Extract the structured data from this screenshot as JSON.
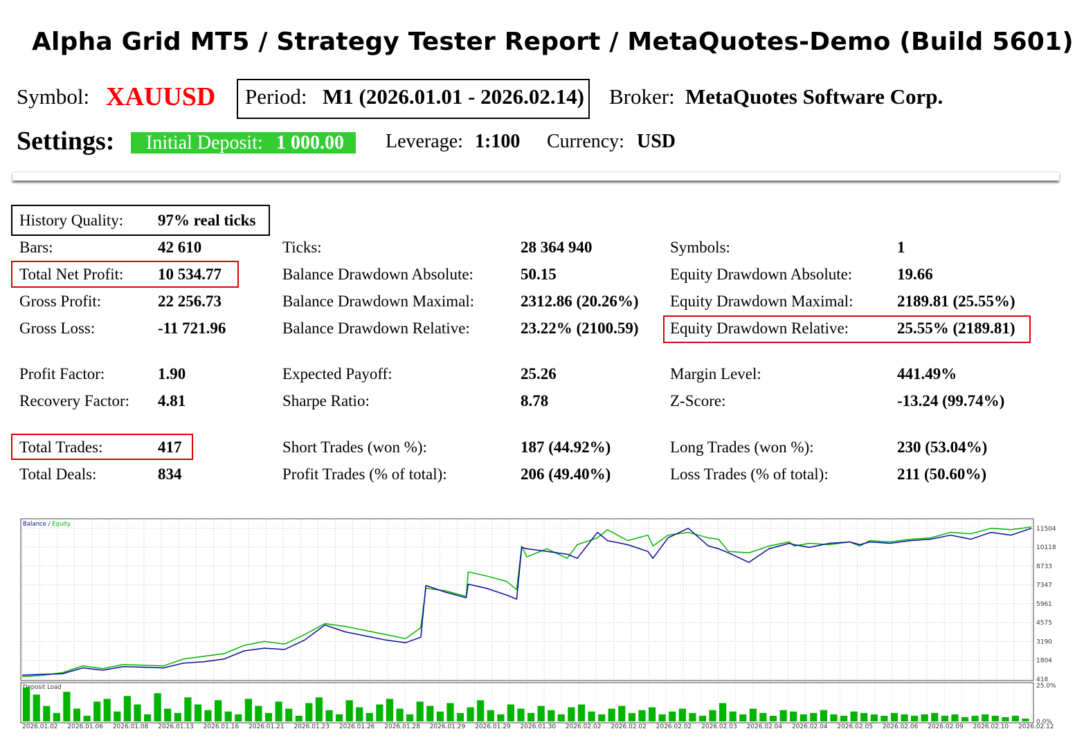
{
  "header": {
    "title": "Alpha Grid MT5  /  Strategy Tester Report  /  MetaQuotes-Demo (Build 5601)",
    "symbol_label": "Symbol:",
    "symbol_value": "XAUUSD",
    "period_label": "Period:",
    "period_value": "M1 (2026.01.01 - 2026.02.14)",
    "broker_label": "Broker:",
    "broker_value": "MetaQuotes Software Corp.",
    "settings_label": "Settings:",
    "deposit_label": "Initial Deposit:",
    "deposit_value": "1 000.00",
    "leverage_label": "Leverage:",
    "leverage_value": "1:100",
    "currency_label": "Currency:",
    "currency_value": "USD"
  },
  "stats": {
    "history_quality": {
      "label": "History Quality:",
      "value": "97% real ticks"
    },
    "bars": {
      "label": "Bars:",
      "value": "42 610"
    },
    "total_net_profit": {
      "label": "Total Net Profit:",
      "value": "10 534.77"
    },
    "gross_profit": {
      "label": "Gross Profit:",
      "value": "22 256.73"
    },
    "gross_loss": {
      "label": "Gross Loss:",
      "value": "-11 721.96"
    },
    "profit_factor": {
      "label": "Profit Factor:",
      "value": "1.90"
    },
    "recovery_factor": {
      "label": "Recovery Factor:",
      "value": "4.81"
    },
    "total_trades": {
      "label": "Total Trades:",
      "value": "417"
    },
    "total_deals": {
      "label": "Total Deals:",
      "value": "834"
    },
    "ticks": {
      "label": "Ticks:",
      "value": "28 364 940"
    },
    "balance_dd_abs": {
      "label": "Balance Drawdown Absolute:",
      "value": "50.15"
    },
    "balance_dd_max": {
      "label": "Balance Drawdown Maximal:",
      "value": "2312.86 (20.26%)"
    },
    "balance_dd_rel": {
      "label": "Balance Drawdown Relative:",
      "value": "23.22% (2100.59)"
    },
    "expected_payoff": {
      "label": "Expected Payoff:",
      "value": "25.26"
    },
    "sharpe_ratio": {
      "label": "Sharpe Ratio:",
      "value": "8.78"
    },
    "short_trades": {
      "label": "Short Trades (won %):",
      "value": "187 (44.92%)"
    },
    "profit_trades": {
      "label": "Profit Trades (% of total):",
      "value": "206 (49.40%)"
    },
    "symbols": {
      "label": "Symbols:",
      "value": "1"
    },
    "equity_dd_abs": {
      "label": "Equity Drawdown Absolute:",
      "value": "19.66"
    },
    "equity_dd_max": {
      "label": "Equity Drawdown Maximal:",
      "value": "2189.81 (25.55%)"
    },
    "equity_dd_rel": {
      "label": "Equity Drawdown Relative:",
      "value": "25.55% (2189.81)"
    },
    "margin_level": {
      "label": "Margin Level:",
      "value": "441.49%"
    },
    "z_score": {
      "label": "Z-Score:",
      "value": "-13.24 (99.74%)"
    },
    "long_trades": {
      "label": "Long Trades (won %):",
      "value": "230 (53.04%)"
    },
    "loss_trades": {
      "label": "Loss Trades (% of total):",
      "value": "211 (50.60%)"
    }
  },
  "colors": {
    "symbol": "#ff0000",
    "deposit_bg": "#33cc33",
    "balance": "#0a0a96",
    "equity": "#00b400",
    "deposit_load": "#00b400",
    "highlight_red": "#e00000"
  },
  "chart_data": [
    {
      "type": "line",
      "title": "",
      "legend": [
        "Balance",
        "Equity"
      ],
      "legend_separator": "/",
      "yticks": [
        418,
        1804,
        3190,
        4575,
        5961,
        7347,
        8733,
        10118,
        11504
      ],
      "ylim": [
        418,
        12000
      ],
      "xlim": [
        0,
        100
      ],
      "grid": true,
      "series": [
        {
          "name": "Balance",
          "color": "#0a0a96",
          "x": [
            0,
            2,
            4,
            6,
            8,
            10,
            12,
            14,
            16,
            18,
            20,
            22,
            24,
            26,
            28,
            30,
            32,
            34,
            36,
            38,
            39.5,
            40,
            42,
            44,
            44.2,
            46,
            48,
            49,
            49.5,
            50,
            52,
            54,
            55,
            57,
            58,
            60,
            62,
            62.5,
            64,
            66,
            68,
            69,
            70,
            72,
            74,
            76,
            76.5,
            78,
            80,
            82,
            83,
            84,
            86,
            88,
            90,
            92,
            94,
            96,
            98,
            100
          ],
          "y": [
            720,
            780,
            820,
            1250,
            1080,
            1350,
            1300,
            1250,
            1600,
            1700,
            1900,
            2500,
            2700,
            2600,
            3300,
            4400,
            3900,
            3600,
            3300,
            3100,
            3500,
            7300,
            6800,
            6400,
            7400,
            7100,
            6600,
            6300,
            10100,
            10000,
            9800,
            9600,
            9300,
            11200,
            10600,
            10300,
            9800,
            9300,
            10800,
            11500,
            10200,
            10000,
            9700,
            9000,
            10000,
            10400,
            10300,
            10100,
            10400,
            10500,
            10300,
            10500,
            10400,
            10600,
            10700,
            11000,
            10700,
            11200,
            11000,
            11504
          ]
        },
        {
          "name": "Equity",
          "color": "#00b400",
          "x": [
            0,
            2,
            4,
            6,
            8,
            10,
            12,
            14,
            16,
            18,
            20,
            22,
            24,
            26,
            28,
            30,
            32,
            34,
            36,
            38,
            39.5,
            40,
            42,
            44,
            44.2,
            46,
            48,
            49,
            49.5,
            50,
            52,
            54,
            55,
            57,
            58,
            60,
            62,
            62.5,
            64,
            66,
            68,
            69,
            70,
            72,
            74,
            76,
            76.5,
            78,
            80,
            82,
            83,
            84,
            86,
            88,
            90,
            92,
            94,
            96,
            98,
            100
          ],
          "y": [
            600,
            700,
            900,
            1400,
            1200,
            1500,
            1450,
            1400,
            1900,
            2100,
            2300,
            2900,
            3200,
            3000,
            3700,
            4500,
            4300,
            4000,
            3700,
            3400,
            4200,
            7100,
            6900,
            6500,
            8300,
            8000,
            7600,
            7000,
            10200,
            9400,
            10000,
            9300,
            10300,
            10800,
            11400,
            10600,
            11000,
            10200,
            11000,
            11200,
            10800,
            10700,
            9800,
            9700,
            10200,
            10500,
            10200,
            10400,
            10300,
            10500,
            10200,
            10600,
            10500,
            10700,
            10800,
            11200,
            11100,
            11500,
            11400,
            11600
          ]
        }
      ]
    },
    {
      "type": "bar",
      "title": "Deposit Load",
      "ytick_labels": [
        "25.0%",
        "0.0%"
      ],
      "ylim": [
        0,
        25
      ],
      "x_tick_labels": [
        "2026.01.02",
        "2026.01.06",
        "2026.01.08",
        "2026.01.13",
        "2026.01.16",
        "2026.01.21",
        "2026.01.23",
        "2026.01.26",
        "2026.01.28",
        "2026.01.29",
        "2026.01.29",
        "2026.01.30",
        "2026.02.02",
        "2026.02.02",
        "2026.02.02",
        "2026.02.03",
        "2026.02.04",
        "2026.02.04",
        "2026.02.05",
        "2026.02.06",
        "2026.02.09",
        "2026.02.10",
        "2026.02.12"
      ],
      "values": [
        24,
        19,
        11,
        6,
        21,
        9,
        4,
        14,
        16,
        7,
        18,
        12,
        5,
        20,
        9,
        6,
        17,
        12,
        8,
        15,
        7,
        5,
        16,
        11,
        6,
        14,
        9,
        4,
        13,
        17,
        8,
        5,
        15,
        10,
        6,
        12,
        16,
        9,
        5,
        14,
        11,
        7,
        13,
        6,
        10,
        15,
        8,
        5,
        12,
        9,
        6,
        11,
        8,
        5,
        10,
        12,
        7,
        5,
        9,
        11,
        6,
        8,
        10,
        5,
        7,
        9,
        6,
        4,
        8,
        13,
        7,
        5,
        9,
        6,
        4,
        8,
        7,
        5,
        6,
        8,
        5,
        4,
        7,
        6,
        5,
        4,
        6,
        5,
        4,
        5,
        6,
        4,
        5,
        3,
        4,
        5,
        4,
        3,
        4,
        2
      ]
    }
  ]
}
